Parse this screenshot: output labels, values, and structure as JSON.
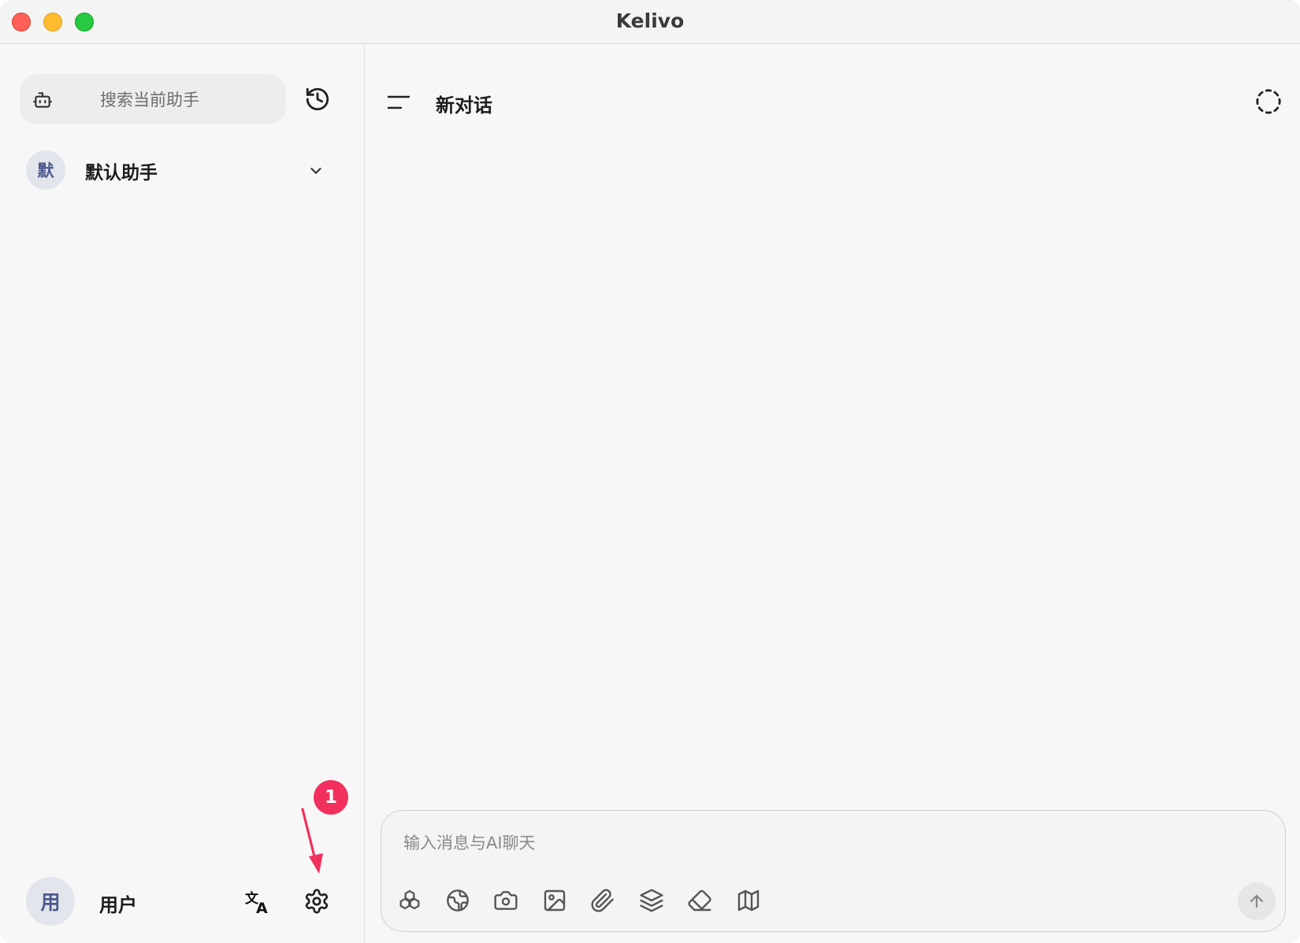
{
  "window": {
    "title": "Kelivo"
  },
  "sidebar": {
    "search": {
      "placeholder": "搜索当前助手"
    },
    "assistant": {
      "avatar_char": "默",
      "name": "默认助手"
    },
    "user": {
      "avatar_char": "用",
      "name": "用户"
    }
  },
  "annotation": {
    "step_number": "1"
  },
  "main": {
    "title": "新对话",
    "composer": {
      "placeholder": "输入消息与AI聊天"
    }
  },
  "colors": {
    "accent_badge": "#f2305e",
    "avatar_bg": "#e3e5ec",
    "avatar_text": "#4d5a8c"
  }
}
